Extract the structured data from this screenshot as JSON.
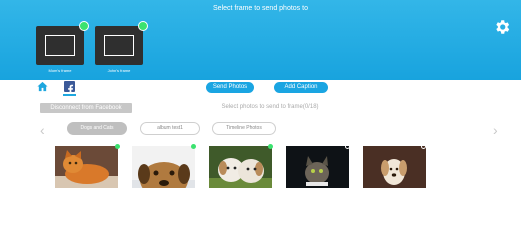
{
  "header": {
    "title": "Select frame to send photos to",
    "settings_icon": "gear-icon",
    "frames": [
      {
        "label": "Mom's frame",
        "status_color": "#3be26f"
      },
      {
        "label": "John's frame",
        "status_color": "#3be26f"
      }
    ]
  },
  "nav": {
    "home_icon": "home-icon",
    "facebook_icon": "facebook-icon",
    "send_photos_label": "Send Photos",
    "add_caption_label": "Add Caption"
  },
  "facebook": {
    "disconnect_label": "Disconnect from Facebook",
    "status_text": "Select photos to send to frame(0/18)"
  },
  "albums": {
    "prev_icon": "chevron-left-icon",
    "next_icon": "chevron-right-icon",
    "tabs": [
      {
        "label": "Dogs and Cats",
        "active": true
      },
      {
        "label": "album test1",
        "active": false
      },
      {
        "label": "Timeline Photos",
        "active": false
      }
    ]
  },
  "photos": [
    {
      "subject": "orange cat",
      "indicator": "green"
    },
    {
      "subject": "dog peeking",
      "indicator": "green"
    },
    {
      "subject": "two puppies",
      "indicator": "green"
    },
    {
      "subject": "tabby cat",
      "indicator": "empty"
    },
    {
      "subject": "small dog",
      "indicator": "empty"
    }
  ],
  "colors": {
    "header_blue": "#1ea7df",
    "button_blue": "#1aa5e2",
    "status_green": "#3be26f",
    "facebook_blue": "#3b5998"
  }
}
